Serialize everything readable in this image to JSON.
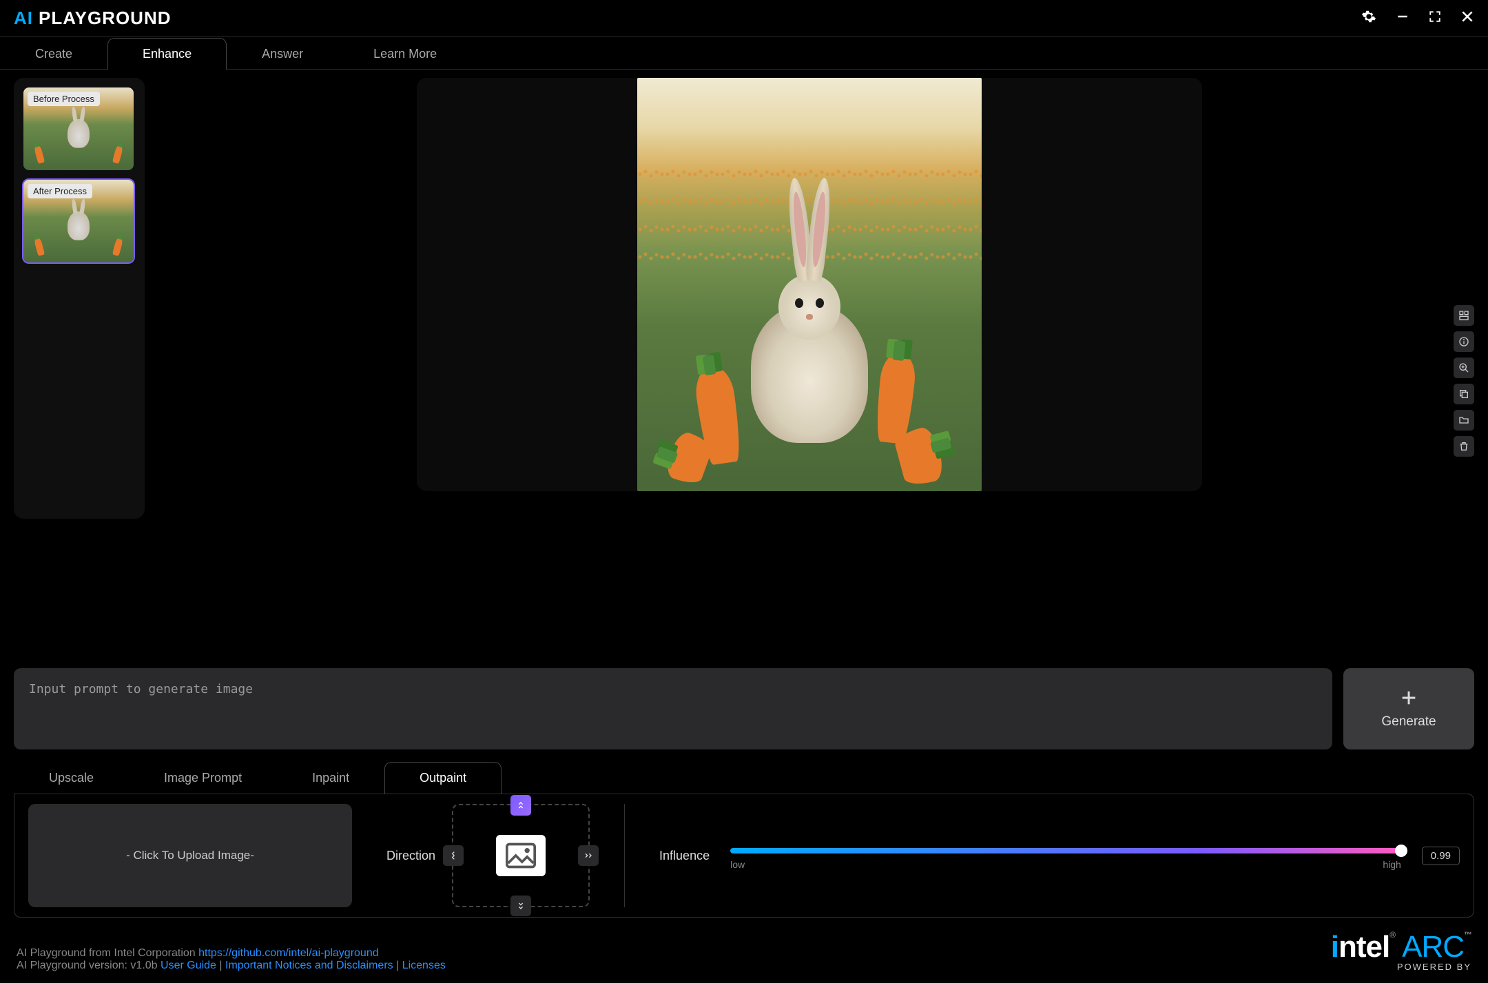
{
  "app": {
    "title_ai": "AI",
    "title_pg": "PLAYGROUND"
  },
  "tabs": {
    "create": "Create",
    "enhance": "Enhance",
    "answer": "Answer",
    "learn_more": "Learn More"
  },
  "thumbs": {
    "before": "Before Process",
    "after": "After Process"
  },
  "prompt": {
    "placeholder": "Input prompt to generate image"
  },
  "generate": {
    "label": "Generate"
  },
  "sub_tabs": {
    "upscale": "Upscale",
    "image_prompt": "Image Prompt",
    "inpaint": "Inpaint",
    "outpaint": "Outpaint"
  },
  "outpaint": {
    "upload_label": "- Click To Upload Image-",
    "direction_label": "Direction",
    "influence_label": "Influence",
    "slider_low": "low",
    "slider_high": "high",
    "slider_value": "0.99"
  },
  "footer": {
    "line1_prefix": "AI Playground from Intel Corporation ",
    "repo_url": "https://github.com/intel/ai-playground",
    "line2_prefix": "AI Playground version: v1.0b ",
    "user_guide": "User Guide",
    "sep": " | ",
    "notices": "Important Notices and Disclaimers",
    "licenses": "Licenses",
    "powered_by": "POWERED BY"
  },
  "brand": {
    "intel": "intel",
    "arc": "ARC"
  }
}
